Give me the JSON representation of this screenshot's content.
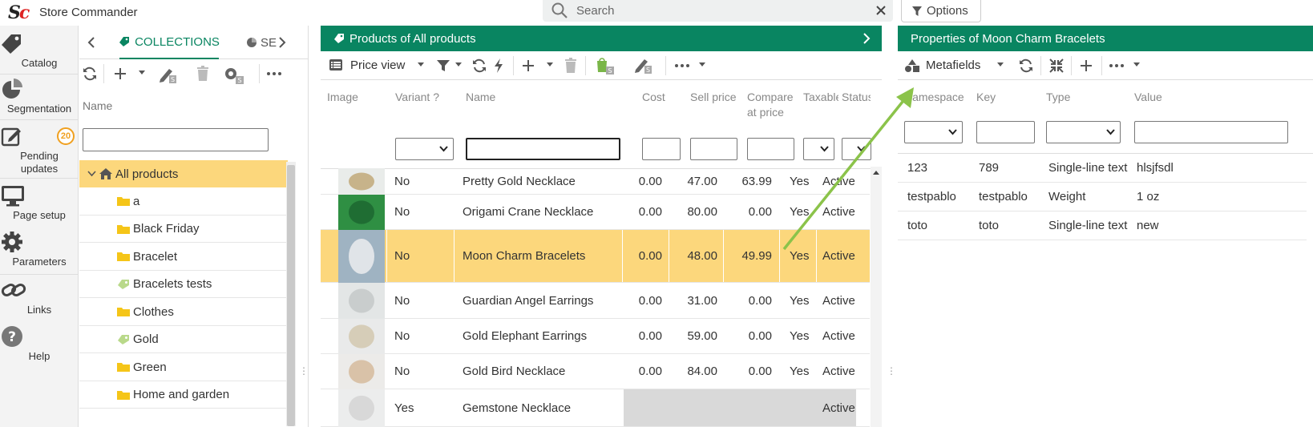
{
  "app": {
    "title": "Store Commander",
    "logo_s": "S",
    "logo_c": "c"
  },
  "search": {
    "placeholder": "Search"
  },
  "options": {
    "label": "Options"
  },
  "nav": {
    "catalog": "Catalog",
    "segmentation": "Segmentation",
    "pending": "Pending updates",
    "pending_badge": "20",
    "page_setup": "Page setup",
    "parameters": "Parameters",
    "links": "Links",
    "help": "Help"
  },
  "collections": {
    "tab_label": "COLLECTIONS",
    "tab2_label": "SE",
    "name_header": "Name",
    "filter_value": "",
    "items": [
      {
        "label": "All products",
        "icon": "home-icon",
        "selected": true
      },
      {
        "label": "a",
        "icon": "folder-icon"
      },
      {
        "label": "Black Friday",
        "icon": "folder-icon"
      },
      {
        "label": "Bracelet",
        "icon": "folder-icon"
      },
      {
        "label": "Bracelets tests",
        "icon": "tag-icon"
      },
      {
        "label": "Clothes",
        "icon": "folder-icon"
      },
      {
        "label": "Gold",
        "icon": "tag-icon"
      },
      {
        "label": "Green",
        "icon": "folder-icon"
      },
      {
        "label": "Home and garden",
        "icon": "folder-icon"
      }
    ]
  },
  "products": {
    "title": "Products of All products",
    "view_label": "Price view",
    "headers": {
      "image": "Image",
      "variant": "Variant ?",
      "name": "Name",
      "cost": "Cost",
      "sell": "Sell price",
      "compare1": "Compare",
      "compare2": "at price",
      "taxable": "Taxable",
      "status": "Status"
    },
    "rows": [
      {
        "variant": "No",
        "name": "Pretty Gold Necklace",
        "cost": "0.00",
        "sell": "47.00",
        "compare": "63.99",
        "taxable": "Yes",
        "status": "Active"
      },
      {
        "variant": "No",
        "name": "Origami Crane Necklace",
        "cost": "0.00",
        "sell": "80.00",
        "compare": "0.00",
        "taxable": "Yes",
        "status": "Active"
      },
      {
        "variant": "No",
        "name": "Moon Charm Bracelets",
        "cost": "0.00",
        "sell": "48.00",
        "compare": "49.99",
        "taxable": "Yes",
        "status": "Active",
        "selected": true
      },
      {
        "variant": "No",
        "name": "Guardian Angel Earrings",
        "cost": "0.00",
        "sell": "31.00",
        "compare": "0.00",
        "taxable": "Yes",
        "status": "Active"
      },
      {
        "variant": "No",
        "name": "Gold Elephant Earrings",
        "cost": "0.00",
        "sell": "59.00",
        "compare": "0.00",
        "taxable": "Yes",
        "status": "Active"
      },
      {
        "variant": "No",
        "name": "Gold Bird Necklace",
        "cost": "0.00",
        "sell": "84.00",
        "compare": "0.00",
        "taxable": "Yes",
        "status": "Active"
      },
      {
        "variant": "Yes",
        "name": "Gemstone Necklace",
        "cost": "",
        "sell": "",
        "compare": "",
        "taxable": "",
        "status": "Active"
      }
    ]
  },
  "properties": {
    "title": "Properties of Moon Charm Bracelets",
    "view_label": "Metafields",
    "headers": {
      "namespace": "Namespace",
      "key": "Key",
      "type": "Type",
      "value": "Value"
    },
    "rows": [
      {
        "namespace": "123",
        "key": "789",
        "type": "Single-line text",
        "value": "hlsjfsdl"
      },
      {
        "namespace": "testpablo",
        "key": "testpablo",
        "type": "Weight",
        "value": "1 oz"
      },
      {
        "namespace": "toto",
        "key": "toto",
        "type": "Single-line text",
        "value": "new"
      }
    ]
  },
  "colors": {
    "brand": "#098561",
    "selection": "#fcd77c",
    "arrow": "#8bc34a",
    "logo_red": "#d22222",
    "badge": "#f0a020"
  }
}
